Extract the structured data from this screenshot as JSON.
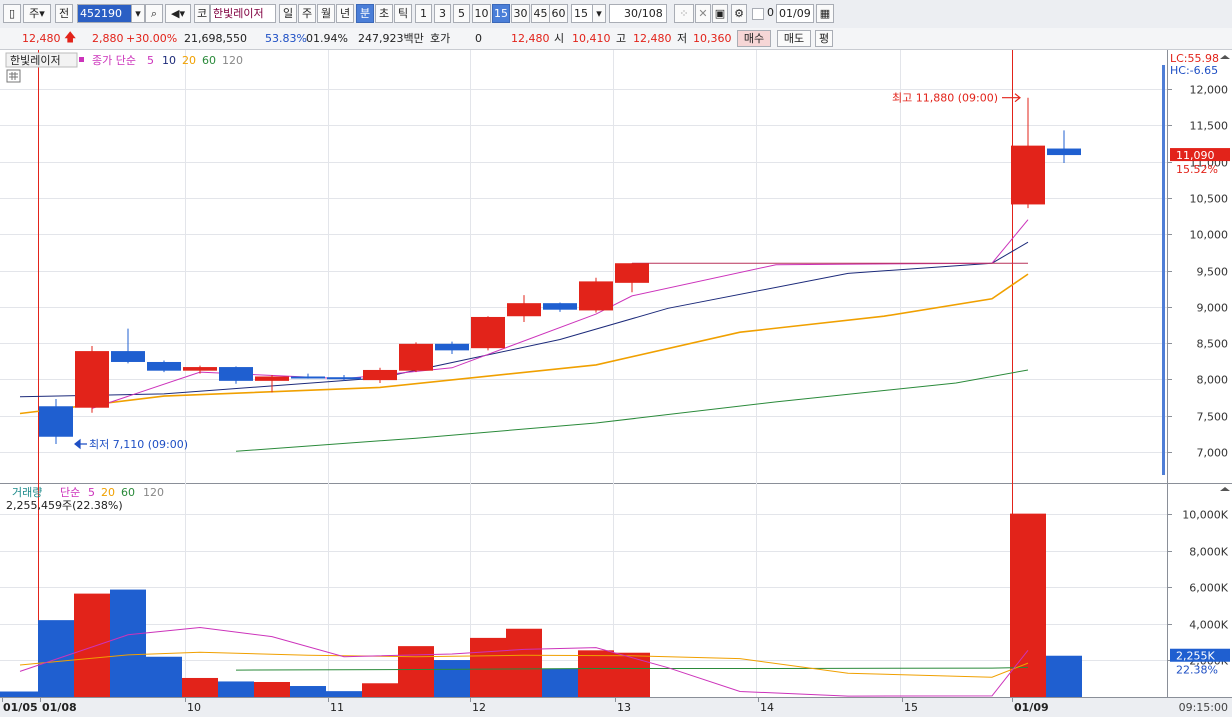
{
  "toolbar": {
    "period_unit": "주",
    "prev_label": "전",
    "code": "452190",
    "market_tag": "코",
    "stock_name": "한빛레이저",
    "periods": [
      "일",
      "주",
      "월",
      "년",
      "분",
      "초",
      "틱"
    ],
    "selected_period": "분",
    "intervals": [
      "1",
      "3",
      "5",
      "10",
      "15",
      "30",
      "45",
      "60"
    ],
    "selected_interval": "15",
    "interval_value": "15",
    "count": "30",
    "count_total": "/108",
    "checkbox_value": "0",
    "date": "01/09"
  },
  "quote": {
    "price": "12,480",
    "change": "2,880",
    "change_pct": "+30.00%",
    "volume": "21,698,550",
    "vol_ratio": "53.83%",
    "turnover_pct": "01.94%",
    "amount": "247,923백만",
    "hoga_label": "호가",
    "hoga_value": "0",
    "hoga_price": "12,480",
    "open_label": "시",
    "open": "10,410",
    "high_label": "고",
    "high": "12,480",
    "low_label": "저",
    "low": "10,360",
    "buy_label": "매수",
    "sell_label": "매도",
    "avg_label": "평"
  },
  "price_panel": {
    "stock_label": "한빛레이저",
    "ma_title": "종가 단순",
    "ma_periods": [
      "5",
      "10",
      "20",
      "60",
      "120"
    ],
    "lc_text": "LC:55.98",
    "hc_text": "HC:-6.65",
    "current_price": "11,090",
    "current_pct": "15.52%",
    "high_annotation": "최고 11,880 (09:00)",
    "low_annotation": "최저 7,110 (09:00)"
  },
  "volume_panel": {
    "title": "거래량",
    "ma_title": "단순",
    "ma_periods": [
      "5",
      "20",
      "60",
      "120"
    ],
    "current_text": "2,255,459주(22.38%)",
    "current_value": "2,255K",
    "current_pct": "22.38%"
  },
  "time_axis": {
    "labels": [
      "01/05",
      "01/08",
      "10",
      "11",
      "12",
      "13",
      "14",
      "15",
      "01/09"
    ],
    "clock": "09:15:00"
  },
  "colors": {
    "up": "#e2231a",
    "down": "#1f5fd0",
    "ma5": "#cc33bb",
    "ma10": "#1c2a7a",
    "ma20": "#f0a000",
    "ma60": "#2a8a3a"
  },
  "chart_data": [
    {
      "type": "candlestick",
      "y_ticks": [
        "12,000",
        "11,500",
        "11,000",
        "10,500",
        "10,000",
        "9,500",
        "9,000",
        "8,500",
        "8,000",
        "7,500",
        "7,000"
      ],
      "ylim": [
        6750,
        12400
      ],
      "candles": [
        {
          "open": 7630,
          "high": 7730,
          "low": 7110,
          "close": 7210
        },
        {
          "open": 7610,
          "high": 8460,
          "low": 7540,
          "close": 8390
        },
        {
          "open": 8390,
          "high": 8700,
          "low": 8220,
          "close": 8240
        },
        {
          "open": 8240,
          "high": 8260,
          "low": 8100,
          "close": 8120
        },
        {
          "open": 8120,
          "high": 8190,
          "low": 8080,
          "close": 8170
        },
        {
          "open": 8170,
          "high": 8180,
          "low": 7940,
          "close": 7980
        },
        {
          "open": 7980,
          "high": 8060,
          "low": 7820,
          "close": 8040
        },
        {
          "open": 8040,
          "high": 8080,
          "low": 8010,
          "close": 8030
        },
        {
          "open": 8030,
          "high": 8060,
          "low": 7980,
          "close": 8010
        },
        {
          "open": 7990,
          "high": 8160,
          "low": 7950,
          "close": 8130
        },
        {
          "open": 8120,
          "high": 8510,
          "low": 8100,
          "close": 8490
        },
        {
          "open": 8490,
          "high": 8520,
          "low": 8350,
          "close": 8400
        },
        {
          "open": 8430,
          "high": 8870,
          "low": 8400,
          "close": 8860
        },
        {
          "open": 8870,
          "high": 9160,
          "low": 8790,
          "close": 9050
        },
        {
          "open": 9050,
          "high": 9060,
          "low": 8930,
          "close": 8960
        },
        {
          "open": 8950,
          "high": 9400,
          "low": 8920,
          "close": 9350
        },
        {
          "open": 9330,
          "high": 9600,
          "low": 9200,
          "close": 9600
        },
        {
          "open": 10410,
          "high": 11880,
          "low": 10360,
          "close": 11220
        },
        {
          "open": 11180,
          "high": 11430,
          "low": 10980,
          "close": 11090
        }
      ],
      "ma5": [
        [
          1,
          7600
        ],
        [
          4,
          8100
        ],
        [
          8,
          8010
        ],
        [
          11,
          8160
        ],
        [
          15,
          8900
        ],
        [
          16,
          9150
        ],
        [
          20,
          9580
        ],
        [
          26,
          9600
        ],
        [
          27,
          10200
        ]
      ],
      "ma10": [
        [
          -1,
          7760
        ],
        [
          3,
          7800
        ],
        [
          9,
          8020
        ],
        [
          14,
          8550
        ],
        [
          17,
          8980
        ],
        [
          22,
          9460
        ],
        [
          26,
          9600
        ],
        [
          27,
          9890
        ]
      ],
      "ma20": [
        [
          -1,
          7530
        ],
        [
          3,
          7770
        ],
        [
          9,
          7890
        ],
        [
          15,
          8200
        ],
        [
          19,
          8650
        ],
        [
          23,
          8870
        ],
        [
          26,
          9110
        ],
        [
          27,
          9450
        ]
      ],
      "ma60": [
        [
          5,
          7010
        ],
        [
          10,
          7190
        ],
        [
          15,
          7400
        ],
        [
          20,
          7690
        ],
        [
          25,
          7950
        ],
        [
          27,
          8130
        ]
      ]
    },
    {
      "type": "bar",
      "y_ticks": [
        "10,000K",
        "8,000K",
        "6,000K",
        "4,000K",
        "2,000K"
      ],
      "ylim": [
        0,
        11000
      ],
      "values": [
        4200,
        5650,
        5870,
        2200,
        1040,
        850,
        820,
        600,
        320,
        750,
        2780,
        2020,
        3230,
        3730,
        1530,
        2550,
        2420,
        10020,
        2255
      ],
      "ma_pink": [
        [
          -1,
          1400
        ],
        [
          2,
          3400
        ],
        [
          4,
          3800
        ],
        [
          6,
          3300
        ],
        [
          8,
          2200
        ],
        [
          11,
          2350
        ],
        [
          13,
          2600
        ],
        [
          15,
          2700
        ],
        [
          17,
          1600
        ],
        [
          19,
          300
        ],
        [
          22,
          50
        ],
        [
          26,
          60
        ],
        [
          27,
          2550
        ]
      ],
      "ma_orange": [
        [
          -1,
          1750
        ],
        [
          2,
          2300
        ],
        [
          4,
          2450
        ],
        [
          7,
          2280
        ],
        [
          10,
          2200
        ],
        [
          13,
          2280
        ],
        [
          16,
          2250
        ],
        [
          19,
          2100
        ],
        [
          22,
          1300
        ],
        [
          26,
          1080
        ],
        [
          27,
          1850
        ]
      ],
      "ma_green": [
        [
          5,
          1470
        ],
        [
          10,
          1500
        ],
        [
          15,
          1560
        ],
        [
          20,
          1560
        ],
        [
          26,
          1580
        ],
        [
          27,
          1620
        ]
      ]
    }
  ]
}
